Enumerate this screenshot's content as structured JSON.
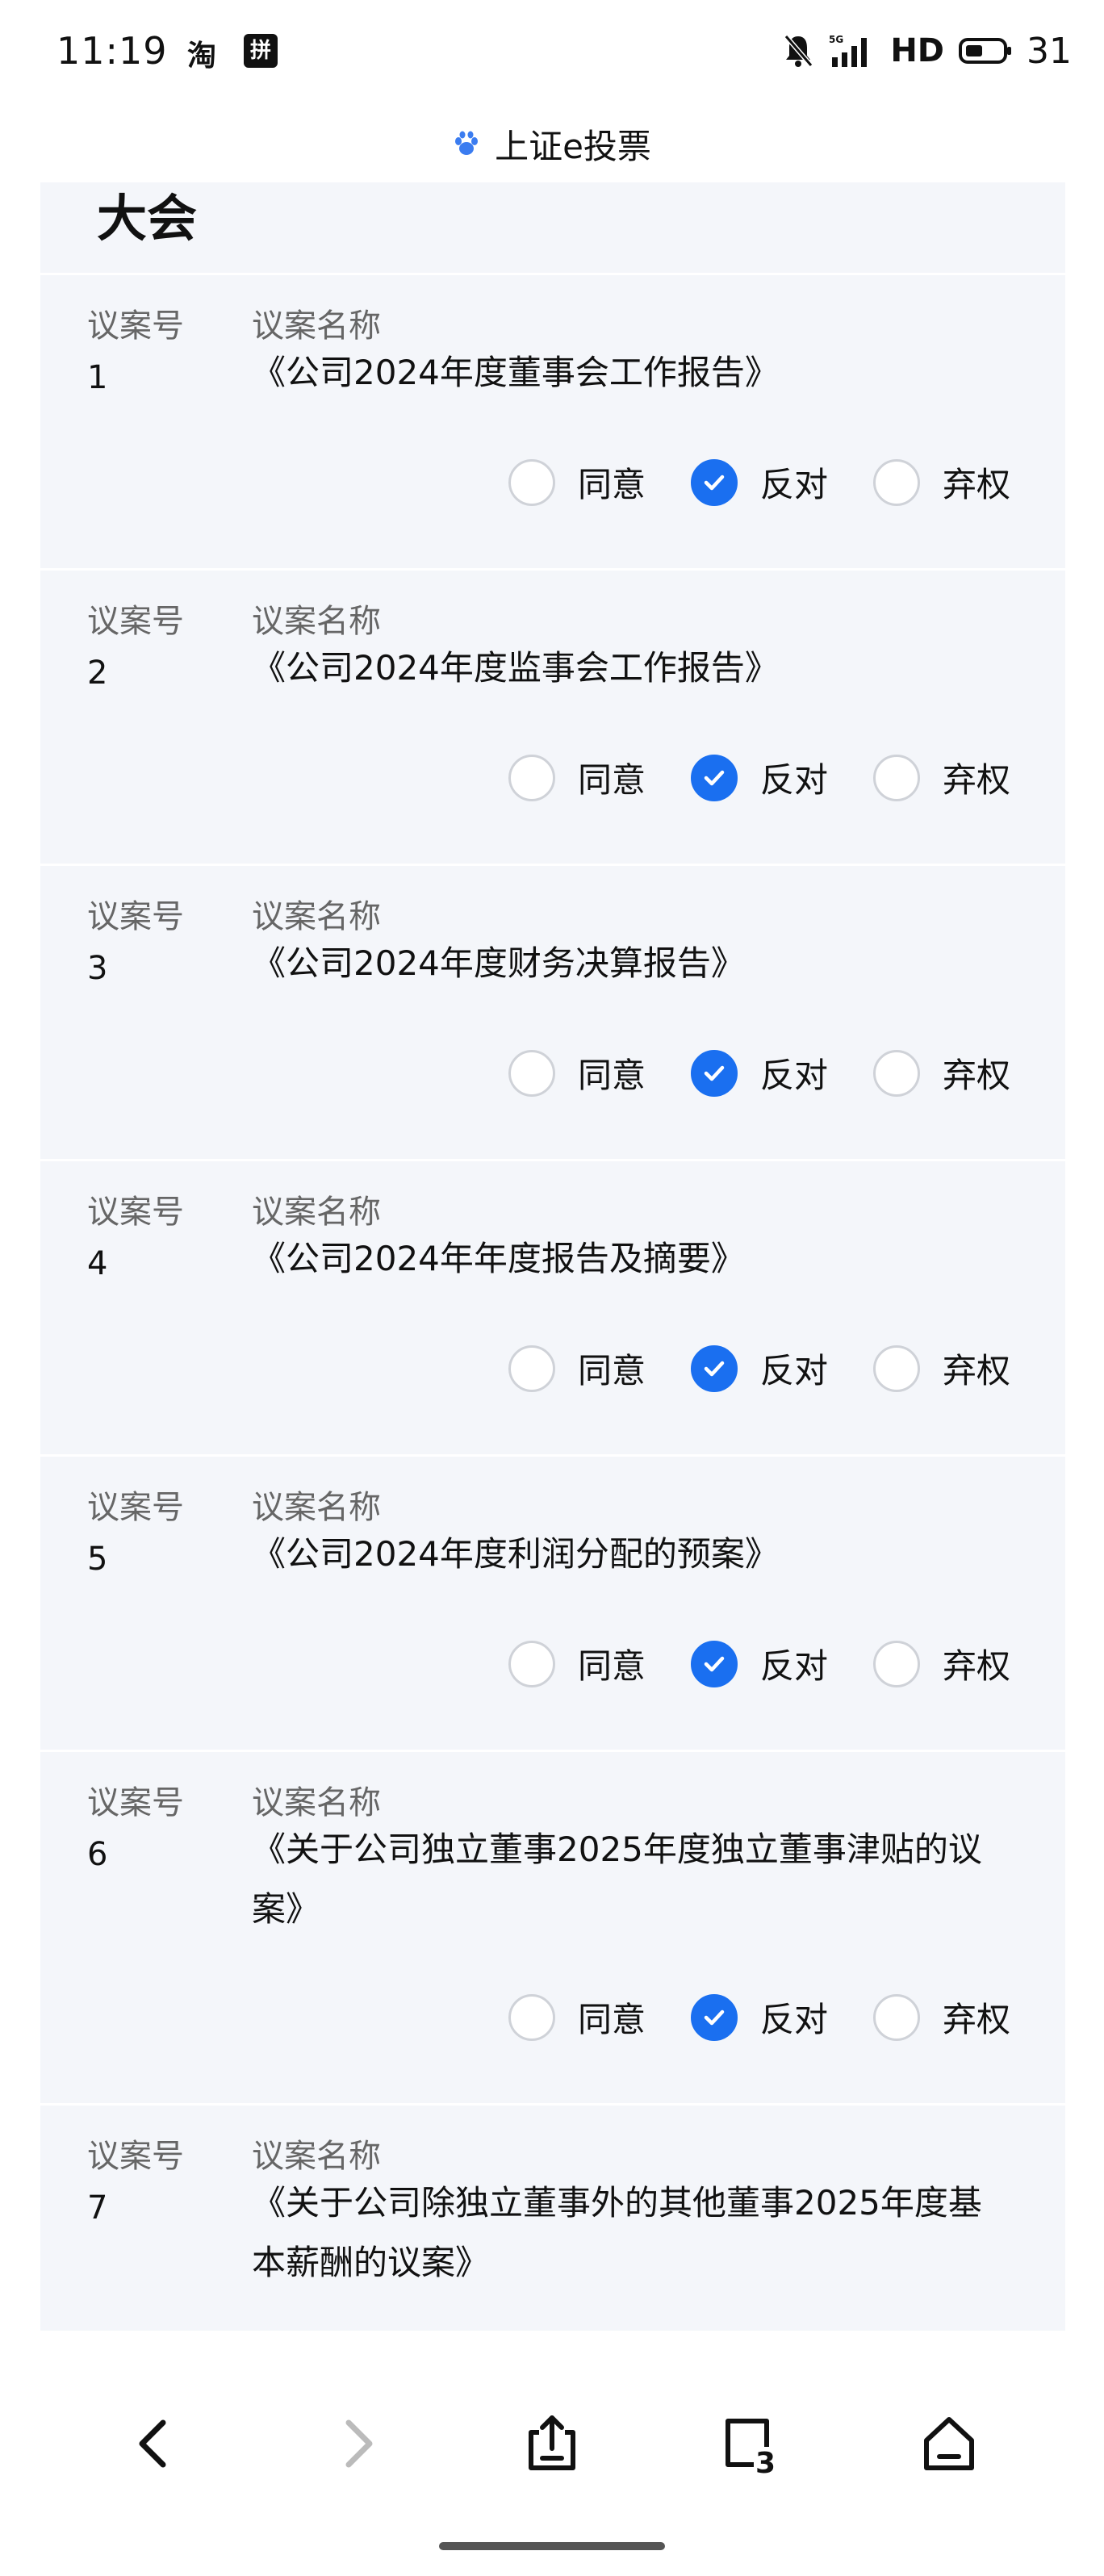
{
  "status_bar": {
    "time": "11:19",
    "app_icon_1": "淘",
    "app_icon_2": "拼",
    "network": "HD",
    "battery": "31"
  },
  "header": {
    "title": "上证e投票",
    "icon": "paw-icon"
  },
  "meeting_label": "大会",
  "table_headers": {
    "no": "议案号",
    "name": "议案名称"
  },
  "options": [
    "同意",
    "反对",
    "弃权"
  ],
  "proposals": [
    {
      "no": "1",
      "name": "《公司2024年度董事会工作报告》",
      "selected": "反对"
    },
    {
      "no": "2",
      "name": "《公司2024年度监事会工作报告》",
      "selected": "反对"
    },
    {
      "no": "3",
      "name": "《公司2024年度财务决算报告》",
      "selected": "反对"
    },
    {
      "no": "4",
      "name": "《公司2024年年度报告及摘要》",
      "selected": "反对"
    },
    {
      "no": "5",
      "name": "《公司2024年度利润分配的预案》",
      "selected": "反对"
    },
    {
      "no": "6",
      "name": "《关于公司独立董事2025年度独立董事津贴的议案》",
      "selected": "反对"
    },
    {
      "no": "7",
      "name": "《关于公司除独立董事外的其他董事2025年度基本薪酬的议案》",
      "selected": null
    }
  ],
  "colors": {
    "accent": "#1a6ff0",
    "card_bg": "#f4f6fa"
  }
}
